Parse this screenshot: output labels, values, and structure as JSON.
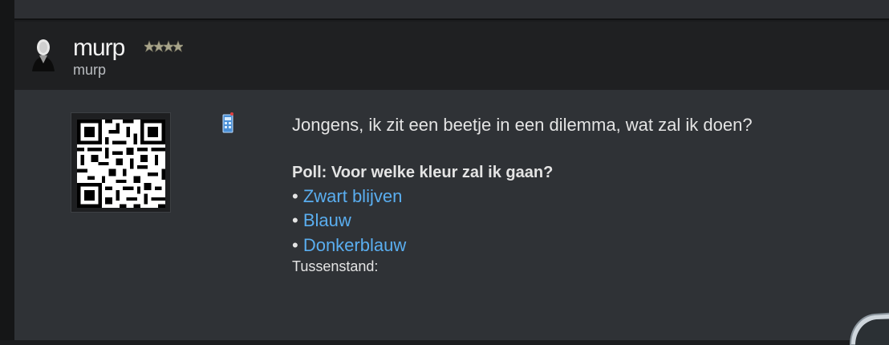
{
  "post": {
    "author": {
      "name": "murp",
      "handle": "murp",
      "avatar_icon": "user-silhouette-icon",
      "rank_icon": "rank-stars-icon"
    },
    "status_icon": "device-icon",
    "message": "Jongens, ik zit een beetje in een dilemma, wat zal ik doen?",
    "poll": {
      "title": "Poll: Voor welke kleur zal ik gaan?",
      "bullet": "•",
      "options": [
        {
          "label": "Zwart blijven"
        },
        {
          "label": "Blauw"
        },
        {
          "label": "Donkerblauw"
        }
      ],
      "tally_label": "Tussenstand:"
    }
  },
  "colors": {
    "link": "#5aaef0",
    "header_bg": "#1f2022",
    "body_bg": "#2f3236"
  }
}
